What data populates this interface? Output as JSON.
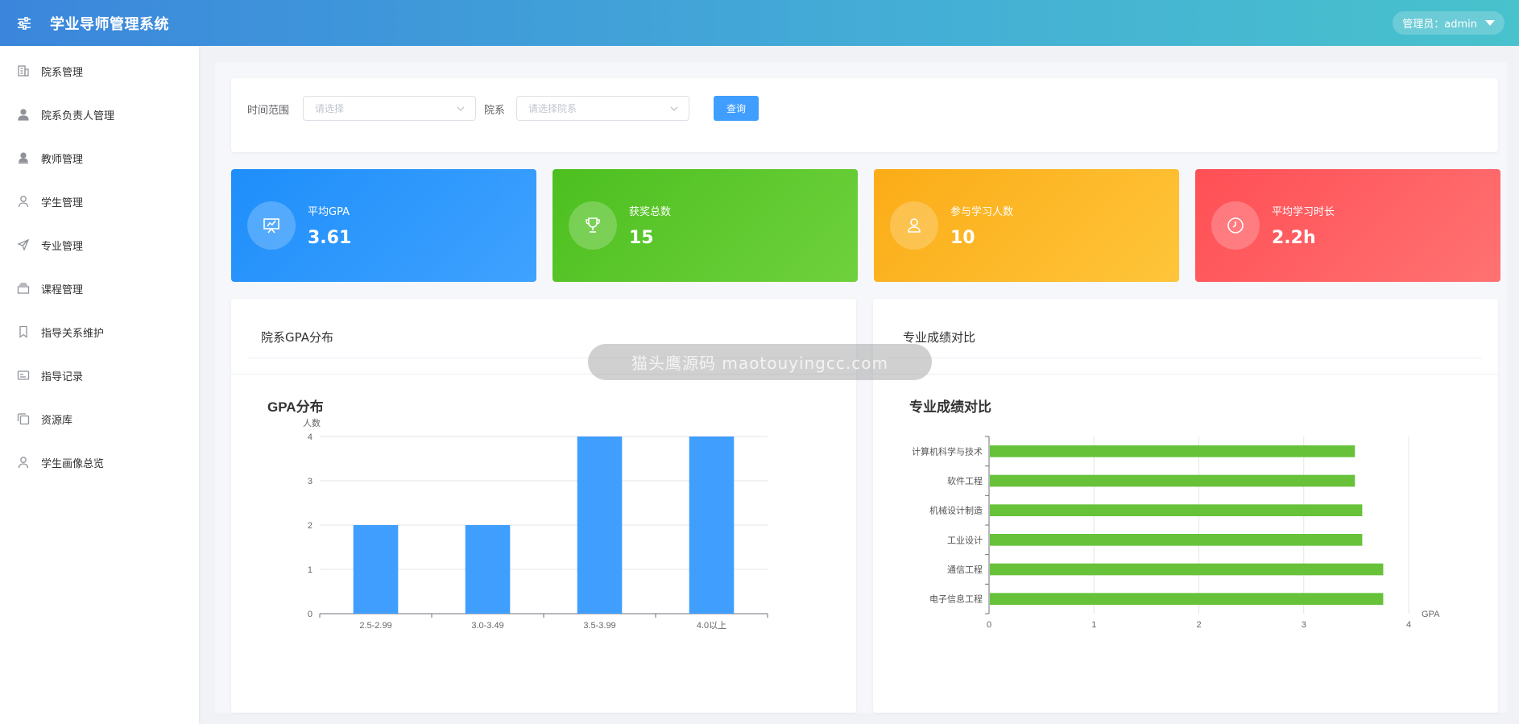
{
  "header": {
    "title": "学业导师管理系统",
    "user_label": "管理员：admin"
  },
  "sidebar": {
    "items": [
      {
        "label": "院系管理",
        "icon": "building-icon"
      },
      {
        "label": "院系负责人管理",
        "icon": "user-filled-icon"
      },
      {
        "label": "教师管理",
        "icon": "teacher-icon"
      },
      {
        "label": "学生管理",
        "icon": "user-icon"
      },
      {
        "label": "专业管理",
        "icon": "send-icon"
      },
      {
        "label": "课程管理",
        "icon": "box-icon"
      },
      {
        "label": "指导关系维护",
        "icon": "bookmark-icon"
      },
      {
        "label": "指导记录",
        "icon": "card-icon"
      },
      {
        "label": "资源库",
        "icon": "copy-icon"
      },
      {
        "label": "学生画像总览",
        "icon": "user-icon"
      }
    ]
  },
  "filter": {
    "time_label": "时间范围",
    "time_placeholder": "请选择",
    "dept_label": "院系",
    "dept_placeholder": "请选择院系",
    "query_button": "查询"
  },
  "stats": [
    {
      "label": "平均GPA",
      "value": "3.61",
      "icon": "presentation-icon",
      "color": "#1e8efa"
    },
    {
      "label": "获奖总数",
      "value": "15",
      "icon": "trophy-icon",
      "color": "#4cbf1f"
    },
    {
      "label": "参与学习人数",
      "value": "10",
      "icon": "user-icon",
      "color": "#fbac17"
    },
    {
      "label": "平均学习时长",
      "value": "2.2h",
      "icon": "clock-icon",
      "color": "#ff4f55"
    }
  ],
  "cards": {
    "left_title": "院系GPA分布",
    "right_title": "专业成绩对比"
  },
  "watermark": "猫头鹰源码 maotouyingcc.com",
  "chart_data": [
    {
      "type": "bar",
      "title": "GPA分布",
      "ylabel": "人数",
      "xlabel": "",
      "categories": [
        "2.5-2.99",
        "3.0-3.49",
        "3.5-3.99",
        "4.0以上"
      ],
      "values": [
        2,
        2,
        4,
        4
      ],
      "ylim": [
        0,
        4
      ],
      "yticks": [
        "0",
        "1",
        "2",
        "3",
        "4"
      ],
      "grid": true,
      "color": "#409eff"
    },
    {
      "type": "bar",
      "orientation": "horizontal",
      "title": "专业成绩对比",
      "xlabel": "GPA",
      "categories": [
        "电子信息工程",
        "通信工程",
        "工业设计",
        "机械设计制造",
        "软件工程",
        "计算机科学与技术"
      ],
      "values": [
        3.75,
        3.75,
        3.55,
        3.55,
        3.48,
        3.48
      ],
      "xlim": [
        0,
        4
      ],
      "xticks": [
        "0",
        "1",
        "2",
        "3",
        "4"
      ],
      "grid": true,
      "color": "#67c23a"
    }
  ]
}
